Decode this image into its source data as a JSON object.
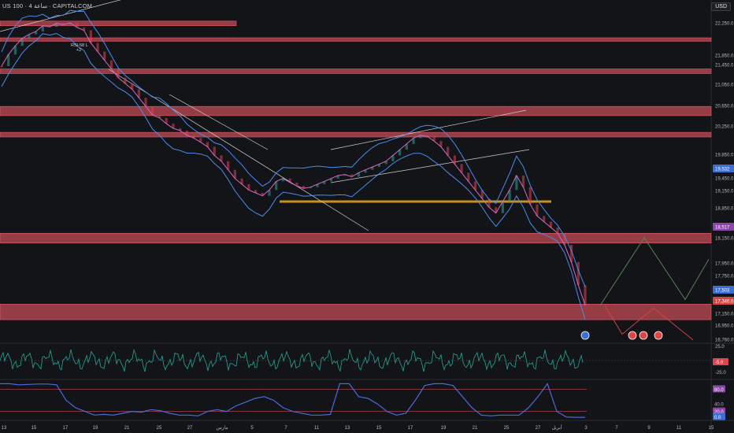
{
  "header": {
    "symbol": "US 100",
    "interval": "4 ساعة",
    "source": "CAPITALCOM",
    "currency": "USD"
  },
  "annotations": {
    "tag": "RSI-58 L",
    "tag2": "+2"
  },
  "colors": {
    "background": "#131417",
    "zone": "#c24a55",
    "bollinger": "#4a8cf0",
    "support_line": "#c6901b",
    "rsi": "#4a6bd8",
    "bullish": "#26a69a",
    "bearish": "#e0444f",
    "projection_up": "#5a8a5a",
    "projection_down": "#d64545"
  },
  "chart_data": {
    "type": "line",
    "price_axis_ticks": [
      "22,250.0",
      "21,850.0",
      "21,450.0",
      "21,050.0",
      "20,650.0",
      "20,250.0",
      "19,850.0",
      "19,450.0",
      "19,150.0",
      "18,850.0",
      "18,517",
      "18,150.0",
      "17,950.0",
      "17,750.0",
      "17,503",
      "17,346.0",
      "17,150.0",
      "16,950.0",
      "16,760.0"
    ],
    "price_labels": [
      {
        "text": "19,532",
        "color": "#3b6fd8"
      },
      {
        "text": "18,517",
        "color": "#8e44ad"
      },
      {
        "text": "17,503",
        "color": "#3b6fd8"
      },
      {
        "text": "17,346.0",
        "color": "#d64545"
      }
    ],
    "x_ticks": [
      "13",
      "15",
      "17",
      "19",
      "21",
      "25",
      "27",
      "مارس",
      "5",
      "7",
      "11",
      "13",
      "15",
      "17",
      "19",
      "21",
      "25",
      "27",
      "أبريل",
      "3",
      "7",
      "9",
      "11",
      "15",
      "1"
    ],
    "resistance_zones": [
      {
        "low": 22200,
        "high": 22280
      },
      {
        "low": 21930,
        "high": 21990
      },
      {
        "low": 21370,
        "high": 21450
      },
      {
        "low": 20640,
        "high": 20800
      },
      {
        "low": 20270,
        "high": 20350
      },
      {
        "low": 18430,
        "high": 18600
      },
      {
        "low": 17100,
        "high": 17370
      }
    ],
    "support_line": 19150,
    "close_series": [
      21500,
      21700,
      21850,
      21980,
      22050,
      22100,
      22200,
      22180,
      22240,
      22220,
      22250,
      22170,
      22120,
      21900,
      21750,
      21600,
      21450,
      21300,
      21200,
      21100,
      20950,
      20800,
      20650,
      20600,
      20500,
      20420,
      20380,
      20300,
      20250,
      20180,
      20100,
      19950,
      19850,
      19700,
      19550,
      19450,
      19350,
      19300,
      19250,
      19350,
      19500,
      19550,
      19480,
      19420,
      19380,
      19400,
      19450,
      19500,
      19550,
      19600,
      19620,
      19580,
      19650,
      19700,
      19750,
      19800,
      19850,
      19950,
      20050,
      20150,
      20250,
      20300,
      20280,
      20200,
      20100,
      19950,
      19800,
      19650,
      19500,
      19350,
      19200,
      19050,
      18950,
      19150,
      19350,
      19600,
      19400,
      19100,
      18900,
      18800,
      18700,
      18600,
      18400,
      18100,
      17700,
      17350
    ],
    "indicator1": {
      "hline": "25.0",
      "value": "-5.6",
      "low": "-25.0"
    },
    "rsi": {
      "upper": "80.0",
      "mid": "40.0",
      "lower": "20.0",
      "value": "0.0",
      "values": [
        95,
        95,
        92,
        93,
        94,
        94,
        92,
        50,
        30,
        20,
        10,
        12,
        10,
        15,
        20,
        18,
        25,
        22,
        15,
        10,
        10,
        8,
        20,
        25,
        20,
        35,
        45,
        55,
        60,
        50,
        30,
        20,
        15,
        10,
        10,
        12,
        95,
        95,
        60,
        55,
        40,
        20,
        10,
        15,
        50,
        90,
        95,
        95,
        90,
        60,
        30,
        10,
        8,
        10,
        10,
        10,
        30,
        60,
        95,
        20,
        5,
        4,
        4
      ]
    },
    "projection": {
      "up": [
        17346,
        18520,
        17450,
        18150
      ],
      "down": [
        17346,
        16850,
        17300,
        16750
      ]
    }
  }
}
